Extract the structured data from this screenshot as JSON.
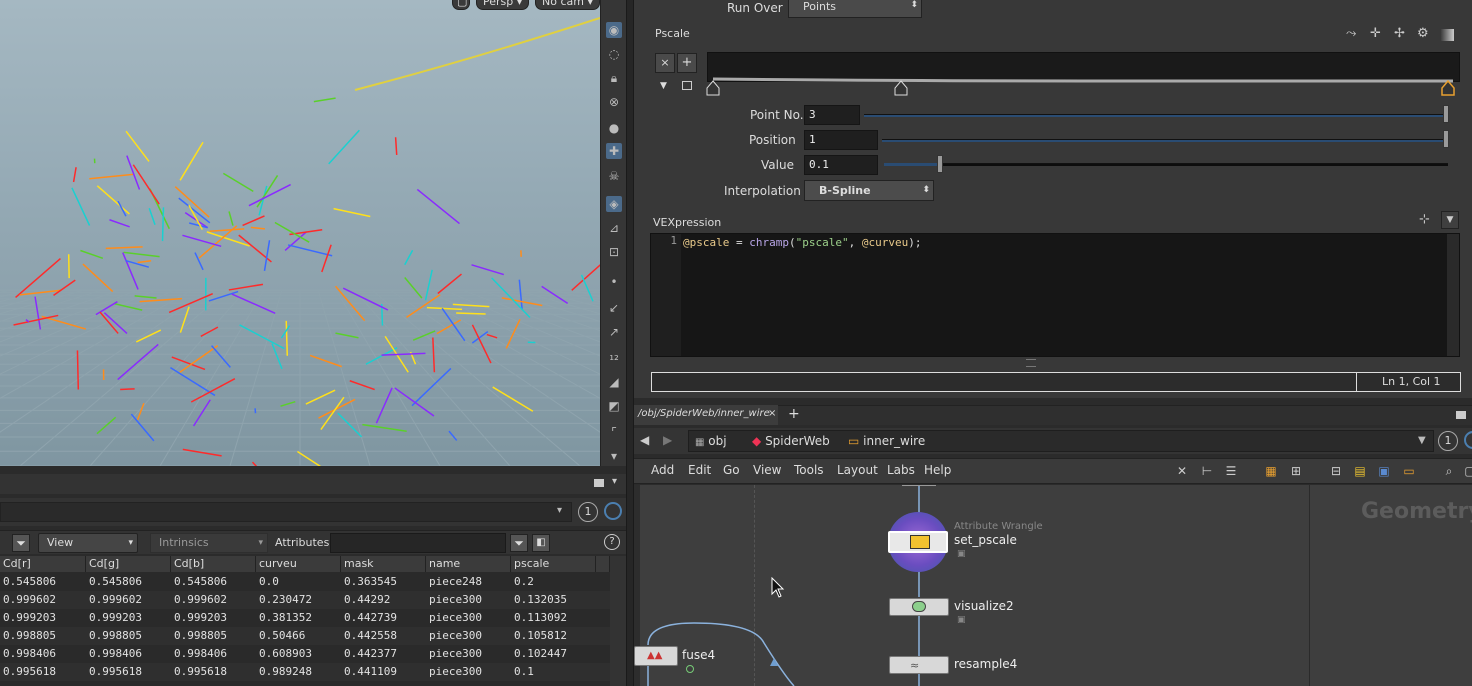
{
  "viewport": {
    "camera_label": "Persp",
    "cam_label": "No cam"
  },
  "spreadsheet": {
    "view_label": "View",
    "intrinsics_label": "Intrinsics",
    "attributes_label": "Attributes:",
    "page_count": "1",
    "help_label": "?",
    "columns": [
      "Cd[r]",
      "Cd[g]",
      "Cd[b]",
      "curveu",
      "mask",
      "name",
      "pscale"
    ],
    "rows": [
      [
        "0.545806",
        "0.545806",
        "0.545806",
        "0.0",
        "0.363545",
        "piece248",
        "0.2"
      ],
      [
        "0.999602",
        "0.999602",
        "0.999602",
        "0.230472",
        "0.44292",
        "piece300",
        "0.132035"
      ],
      [
        "0.999203",
        "0.999203",
        "0.999203",
        "0.381352",
        "0.442739",
        "piece300",
        "0.113092"
      ],
      [
        "0.998805",
        "0.998805",
        "0.998805",
        "0.50466",
        "0.442558",
        "piece300",
        "0.105812"
      ],
      [
        "0.998406",
        "0.998406",
        "0.998406",
        "0.608903",
        "0.442377",
        "piece300",
        "0.102447"
      ],
      [
        "0.995618",
        "0.995618",
        "0.995618",
        "0.989248",
        "0.441109",
        "piece300",
        "0.1"
      ]
    ]
  },
  "params": {
    "run_over_label": "Run Over",
    "run_over_value": "Points",
    "pscale_label": "Pscale",
    "point_no_label": "Point No.",
    "point_no_value": "3",
    "position_label": "Position",
    "position_value": "1",
    "value_label": "Value",
    "value_value": "0.1",
    "value_level": 0.1,
    "interpolation_label": "Interpolation",
    "interpolation_value": "B-Spline",
    "vex_label": "VEXpression",
    "line_number": "1",
    "code": "@pscale = chramp(\"pscale\", @curveu);",
    "cursor_status": "Ln 1, Col 1"
  },
  "network": {
    "tab_label": "/obj/SpiderWeb/inner_wire",
    "path": [
      "obj",
      "SpiderWeb",
      "inner_wire"
    ],
    "page_count": "1",
    "menus": [
      "Add",
      "Edit",
      "Go",
      "View",
      "Tools",
      "Layout",
      "Labs",
      "Help"
    ],
    "context_watermark": "Geometry",
    "nodes": {
      "set_pscale_type": "Attribute Wrangle",
      "set_pscale": "set_pscale",
      "visualize": "visualize2",
      "resample": "resample4",
      "fuse": "fuse4"
    }
  }
}
